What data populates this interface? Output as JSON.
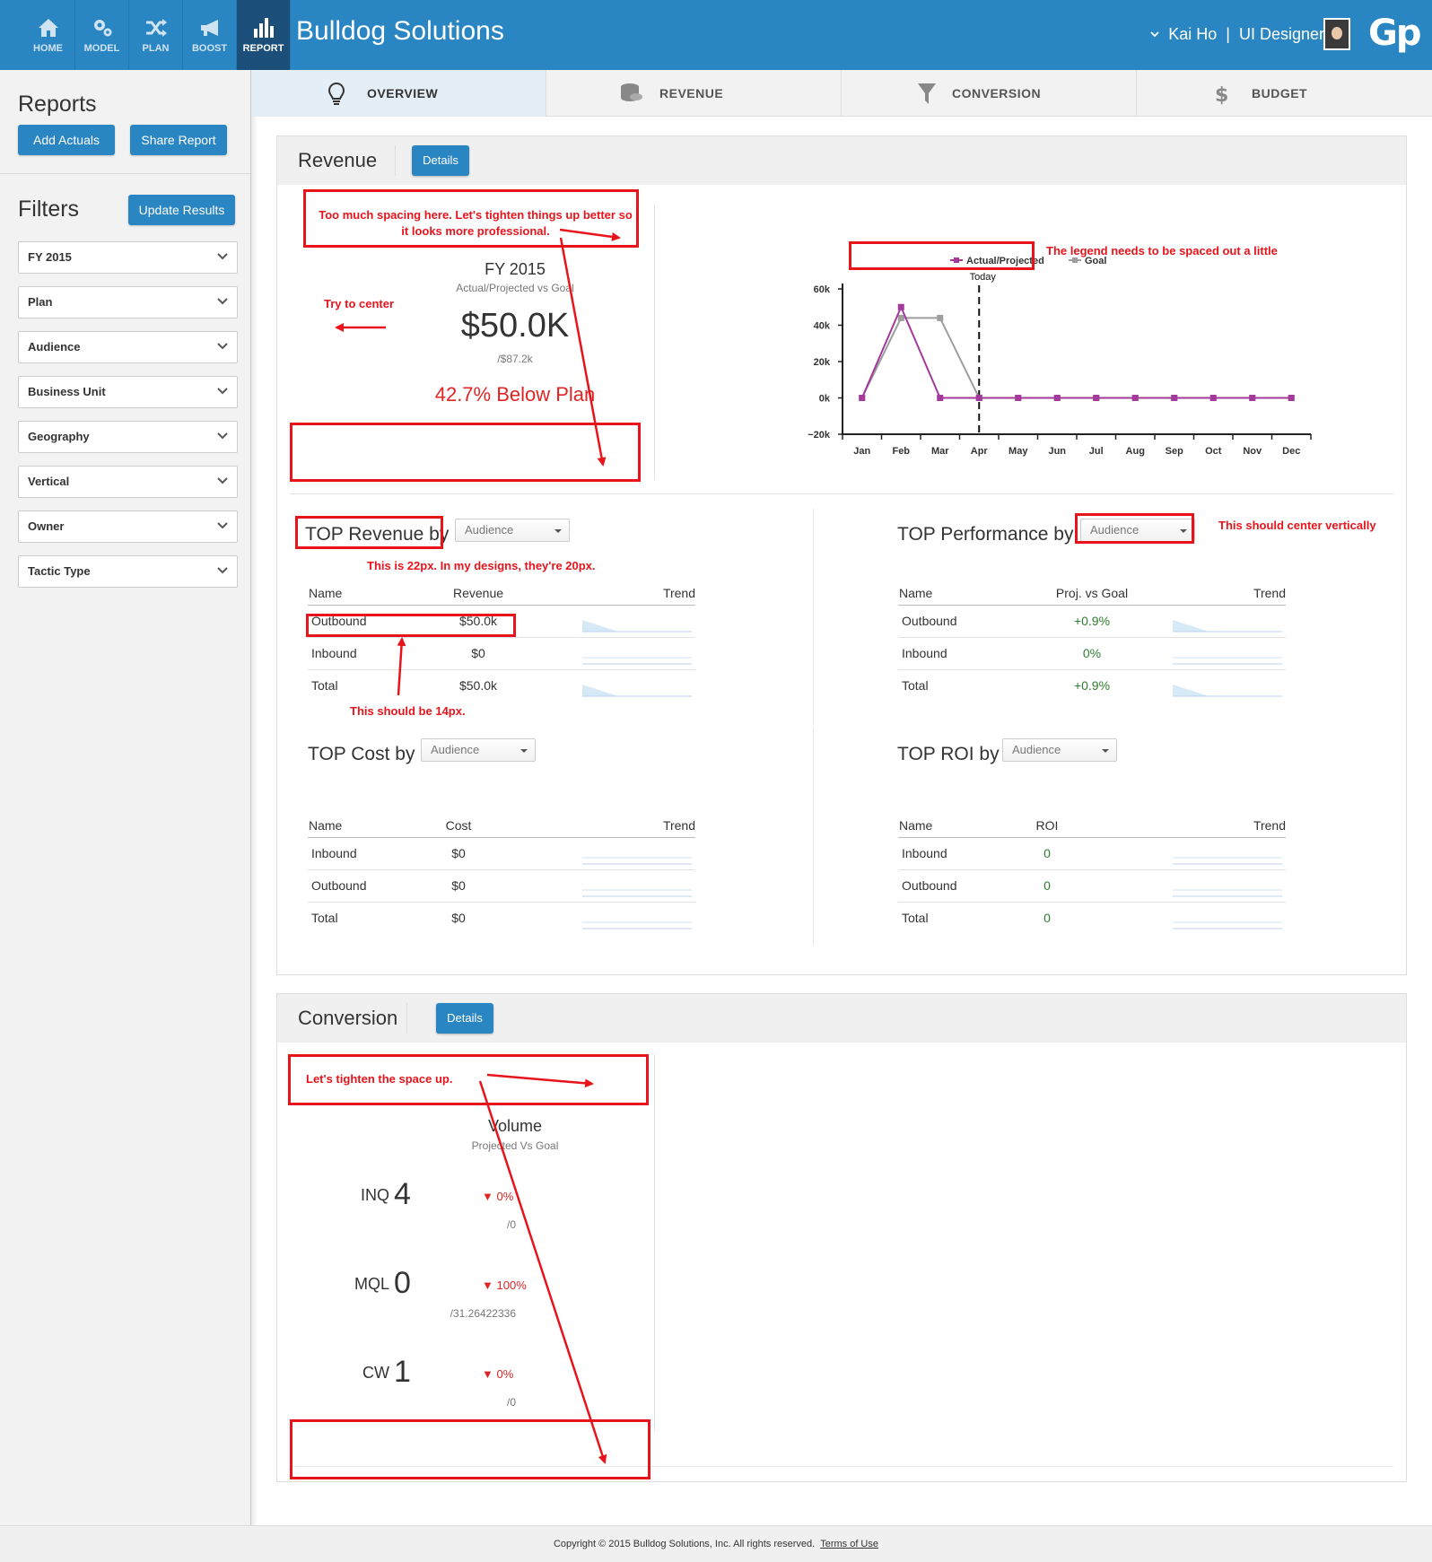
{
  "nav": {
    "items": [
      {
        "label": "HOME"
      },
      {
        "label": "MODEL"
      },
      {
        "label": "PLAN"
      },
      {
        "label": "BOOST"
      },
      {
        "label": "REPORT"
      }
    ],
    "brand": "Bulldog Solutions",
    "user_name": "Kai Ho",
    "user_role": "UI Designer",
    "logo": "Gp"
  },
  "sidebar": {
    "reports_title": "Reports",
    "add_actuals": "Add Actuals",
    "share_report": "Share Report",
    "filters_title": "Filters",
    "update_results": "Update Results",
    "filters": [
      "FY 2015",
      "Plan",
      "Audience",
      "Business Unit",
      "Geography",
      "Vertical",
      "Owner",
      "Tactic Type"
    ]
  },
  "tabs": [
    {
      "label": "OVERVIEW",
      "icon": "lightbulb-icon"
    },
    {
      "label": "REVENUE",
      "icon": "coins-icon"
    },
    {
      "label": "CONVERSION",
      "icon": "funnel-icon"
    },
    {
      "label": "BUDGET",
      "icon": "dollar-icon"
    }
  ],
  "revenue": {
    "title": "Revenue",
    "details": "Details",
    "kpi": {
      "title": "FY 2015",
      "subtitle": "Actual/Projected vs Goal",
      "value": "$50.0K",
      "of": "/$87.2k",
      "status": "42.7% Below Plan"
    },
    "top_revenue": {
      "title": "TOP Revenue by",
      "select": "Audience",
      "headers": [
        "Name",
        "Revenue",
        "Trend"
      ],
      "rows": [
        {
          "name": "Outbound",
          "value": "$50.0k"
        },
        {
          "name": "Inbound",
          "value": "$0"
        },
        {
          "name": "Total",
          "value": "$50.0k"
        }
      ]
    },
    "top_performance": {
      "title": "TOP Performance by",
      "select": "Audience",
      "headers": [
        "Name",
        "Proj. vs Goal",
        "Trend"
      ],
      "rows": [
        {
          "name": "Outbound",
          "value": "+0.9%"
        },
        {
          "name": "Inbound",
          "value": "0%"
        },
        {
          "name": "Total",
          "value": "+0.9%"
        }
      ]
    },
    "top_cost": {
      "title": "TOP Cost by",
      "select": "Audience",
      "headers": [
        "Name",
        "Cost",
        "Trend"
      ],
      "rows": [
        {
          "name": "Inbound",
          "value": "$0"
        },
        {
          "name": "Outbound",
          "value": "$0"
        },
        {
          "name": "Total",
          "value": "$0"
        }
      ]
    },
    "top_roi": {
      "title": "TOP ROI by",
      "select": "Audience",
      "headers": [
        "Name",
        "ROI",
        "Trend"
      ],
      "rows": [
        {
          "name": "Inbound",
          "value": "0"
        },
        {
          "name": "Outbound",
          "value": "0"
        },
        {
          "name": "Total",
          "value": "0"
        }
      ]
    }
  },
  "chart_data": {
    "type": "line",
    "categories": [
      "Jan",
      "Feb",
      "Mar",
      "Apr",
      "May",
      "Jun",
      "Jul",
      "Aug",
      "Sep",
      "Oct",
      "Nov",
      "Dec"
    ],
    "series": [
      {
        "name": "Actual/Projected",
        "color": "#a3399a",
        "values": [
          0,
          50,
          0,
          0,
          0,
          0,
          0,
          0,
          0,
          0,
          0,
          0
        ]
      },
      {
        "name": "Goal",
        "color": "#9e9e9e",
        "values": [
          0,
          44,
          44,
          0,
          0,
          0,
          0,
          0,
          0,
          0,
          0,
          0
        ]
      }
    ],
    "y_ticks": [
      "60k",
      "40k",
      "20k",
      "0k",
      "−20k"
    ],
    "ylim": [
      -20,
      60
    ],
    "today_label": "Today",
    "today_marker": "Apr",
    "legend_position": "top"
  },
  "conversion": {
    "title": "Conversion",
    "details": "Details",
    "volume_title": "Volume",
    "volume_subtitle": "Projected Vs Goal",
    "rows": [
      {
        "label": "INQ",
        "value": "4",
        "pct": "0%",
        "of": "/0"
      },
      {
        "label": "MQL",
        "value": "0",
        "pct": "100%",
        "of": "/31.26422336"
      },
      {
        "label": "CW",
        "value": "1",
        "pct": "0%",
        "of": "/0"
      }
    ]
  },
  "annotations": {
    "spacing": "Too much spacing here. Let's tighten things up better so it looks more professional.",
    "center": "Try to center",
    "legend": "The legend needs to be spaced out a little",
    "center_vertically": "This should center vertically",
    "font_22": "This is 22px. In my designs, they're 20px.",
    "font_14": "This should be 14px.",
    "tighten": "Let's tighten the space up."
  },
  "footer": {
    "copyright": "Copyright © 2015 Bulldog Solutions, Inc. All rights reserved.",
    "terms": "Terms of Use"
  }
}
